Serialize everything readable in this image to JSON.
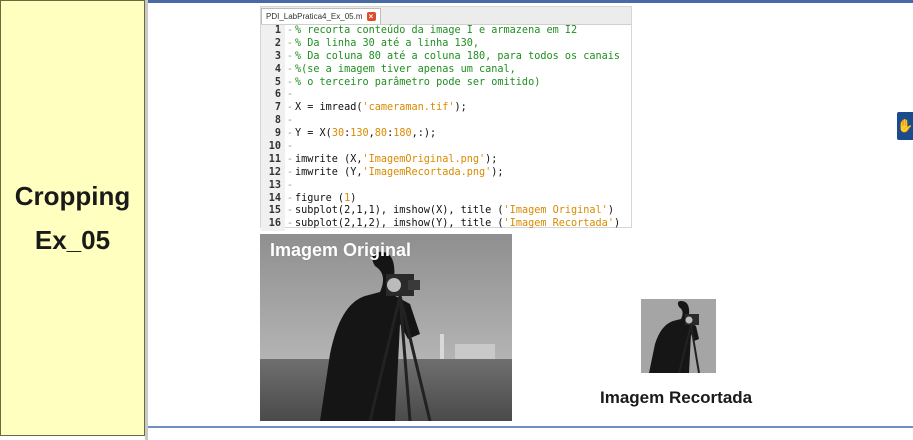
{
  "slide": {
    "title_line1": "Cropping",
    "title_line2": "Ex_05"
  },
  "editor": {
    "tab_label": "PDI_LabPratica4_Ex_05.m",
    "lines": [
      {
        "num": "1",
        "segments": [
          {
            "t": "cmt",
            "v": "% recorta conteúdo da image I e armazena em I2"
          }
        ]
      },
      {
        "num": "2",
        "segments": [
          {
            "t": "cmt",
            "v": "% Da linha 30 até a linha 130,"
          }
        ]
      },
      {
        "num": "3",
        "segments": [
          {
            "t": "cmt",
            "v": "% Da coluna 80 até a coluna 180, para todos os canais"
          }
        ]
      },
      {
        "num": "4",
        "segments": [
          {
            "t": "cmt",
            "v": "%(se a imagem tiver apenas um canal,"
          }
        ]
      },
      {
        "num": "5",
        "segments": [
          {
            "t": "cmt",
            "v": "% o terceiro parâmetro pode ser omitido)"
          }
        ]
      },
      {
        "num": "6",
        "segments": []
      },
      {
        "num": "7",
        "segments": [
          {
            "t": "txt",
            "v": "X = imread("
          },
          {
            "t": "str",
            "v": "'cameraman.tif'"
          },
          {
            "t": "txt",
            "v": ");"
          }
        ]
      },
      {
        "num": "8",
        "segments": []
      },
      {
        "num": "9",
        "segments": [
          {
            "t": "txt",
            "v": "Y = X("
          },
          {
            "t": "str",
            "v": "30"
          },
          {
            "t": "txt",
            "v": ":"
          },
          {
            "t": "str",
            "v": "130"
          },
          {
            "t": "txt",
            "v": ","
          },
          {
            "t": "str",
            "v": "80"
          },
          {
            "t": "txt",
            "v": ":"
          },
          {
            "t": "str",
            "v": "180"
          },
          {
            "t": "txt",
            "v": ",:);"
          }
        ]
      },
      {
        "num": "10",
        "segments": []
      },
      {
        "num": "11",
        "segments": [
          {
            "t": "txt",
            "v": "imwrite (X,"
          },
          {
            "t": "str",
            "v": "'ImagemOriginal.png'"
          },
          {
            "t": "txt",
            "v": ");"
          }
        ]
      },
      {
        "num": "12",
        "segments": [
          {
            "t": "txt",
            "v": "imwrite (Y,"
          },
          {
            "t": "str",
            "v": "'ImagemRecortada.png'"
          },
          {
            "t": "txt",
            "v": ");"
          }
        ]
      },
      {
        "num": "13",
        "segments": []
      },
      {
        "num": "14",
        "segments": [
          {
            "t": "txt",
            "v": "figure ("
          },
          {
            "t": "str",
            "v": "1"
          },
          {
            "t": "txt",
            "v": ")"
          }
        ]
      },
      {
        "num": "15",
        "segments": [
          {
            "t": "txt",
            "v": "subplot(2,1,1), imshow(X), title ("
          },
          {
            "t": "str",
            "v": "'Imagem Original'"
          },
          {
            "t": "txt",
            "v": ")"
          }
        ]
      },
      {
        "num": "16",
        "segments": [
          {
            "t": "txt",
            "v": "subplot(2,1,2), imshow(Y), title ("
          },
          {
            "t": "str",
            "v": "'Imagem Recortada'"
          },
          {
            "t": "txt",
            "v": ")"
          }
        ]
      }
    ]
  },
  "figure": {
    "original_label": "Imagem Original",
    "cropped_label": "Imagem Recortada"
  },
  "icons": {
    "accessibility": "accessibility-hand-icon",
    "tab_close": "close-icon"
  },
  "colors": {
    "panel_bg": "#ffffc0",
    "rule": "#4a6aa5",
    "comment": "#1f8f1f",
    "string": "#d98a00"
  }
}
